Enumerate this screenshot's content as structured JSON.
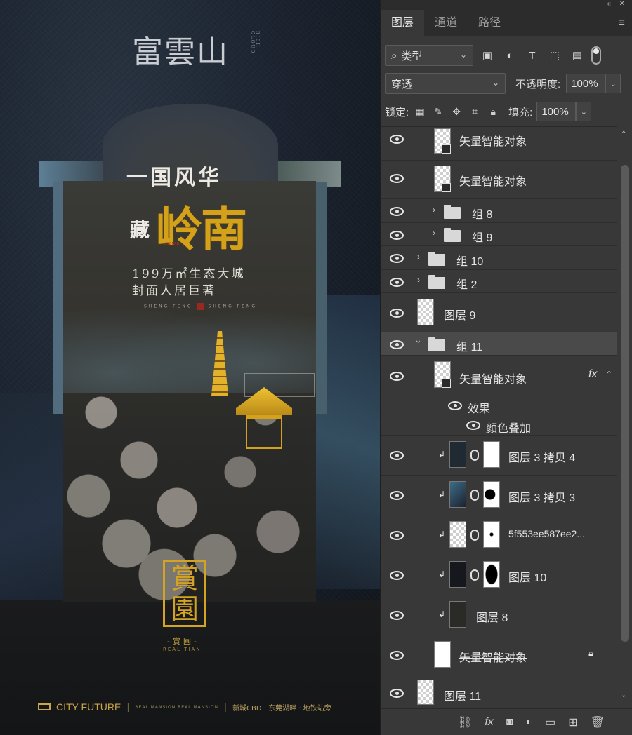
{
  "canvas": {
    "top_logo": "富雲山",
    "top_logo_side": "RICH CLOUD",
    "headline": "一国风华",
    "hidden_char": "藏",
    "big_title": "岭南",
    "seal_text": "LINGNAN",
    "intro_line_1": "199万㎡生态大城",
    "intro_line_2": "封面人居巨著",
    "small_caps_left": "SHENG FENG",
    "small_caps_right": "SHENG FENG",
    "brand_mark": "賞園",
    "brand_cn": "-賞園-",
    "brand_en": "REAL TIAN",
    "footer": {
      "company": "CITY FUTURE",
      "small": "REAL MANSION REAL MANSION",
      "tags": "新城CBD · 东莞湖畔 · 地铁站旁"
    }
  },
  "panel": {
    "tabs": [
      "图层",
      "通道",
      "路径"
    ],
    "filter": {
      "kind_label": "类型"
    },
    "blend_mode": "穿透",
    "opacity_label": "不透明度:",
    "opacity_value": "100%",
    "lock_label": "锁定:",
    "fill_label": "填充:",
    "fill_value": "100%",
    "layers": [
      {
        "name": "矢量智能对象",
        "type": "smart"
      },
      {
        "name": "矢量智能对象",
        "type": "smart"
      },
      {
        "name": "组 8",
        "type": "group"
      },
      {
        "name": "组 9",
        "type": "group"
      },
      {
        "name": "组 10",
        "type": "group"
      },
      {
        "name": "组 2",
        "type": "group"
      },
      {
        "name": "图层 9",
        "type": "layer"
      },
      {
        "name": "组 11",
        "type": "group-open"
      },
      {
        "name": "矢量智能对象",
        "type": "smart-fx"
      },
      {
        "name": "效果",
        "type": "effects"
      },
      {
        "name": "颜色叠加",
        "type": "effect-item"
      },
      {
        "name": "图层 3 拷贝 4",
        "type": "masked"
      },
      {
        "name": "图层 3 拷贝 3",
        "type": "masked"
      },
      {
        "name": "5f553ee587ee2...",
        "type": "masked"
      },
      {
        "name": "图层 10",
        "type": "masked"
      },
      {
        "name": "图层 8",
        "type": "clipped"
      },
      {
        "name": "矢量智能对象",
        "type": "smart-locked"
      },
      {
        "name": "图层 11",
        "type": "layer"
      }
    ],
    "fx_label": "fx"
  }
}
